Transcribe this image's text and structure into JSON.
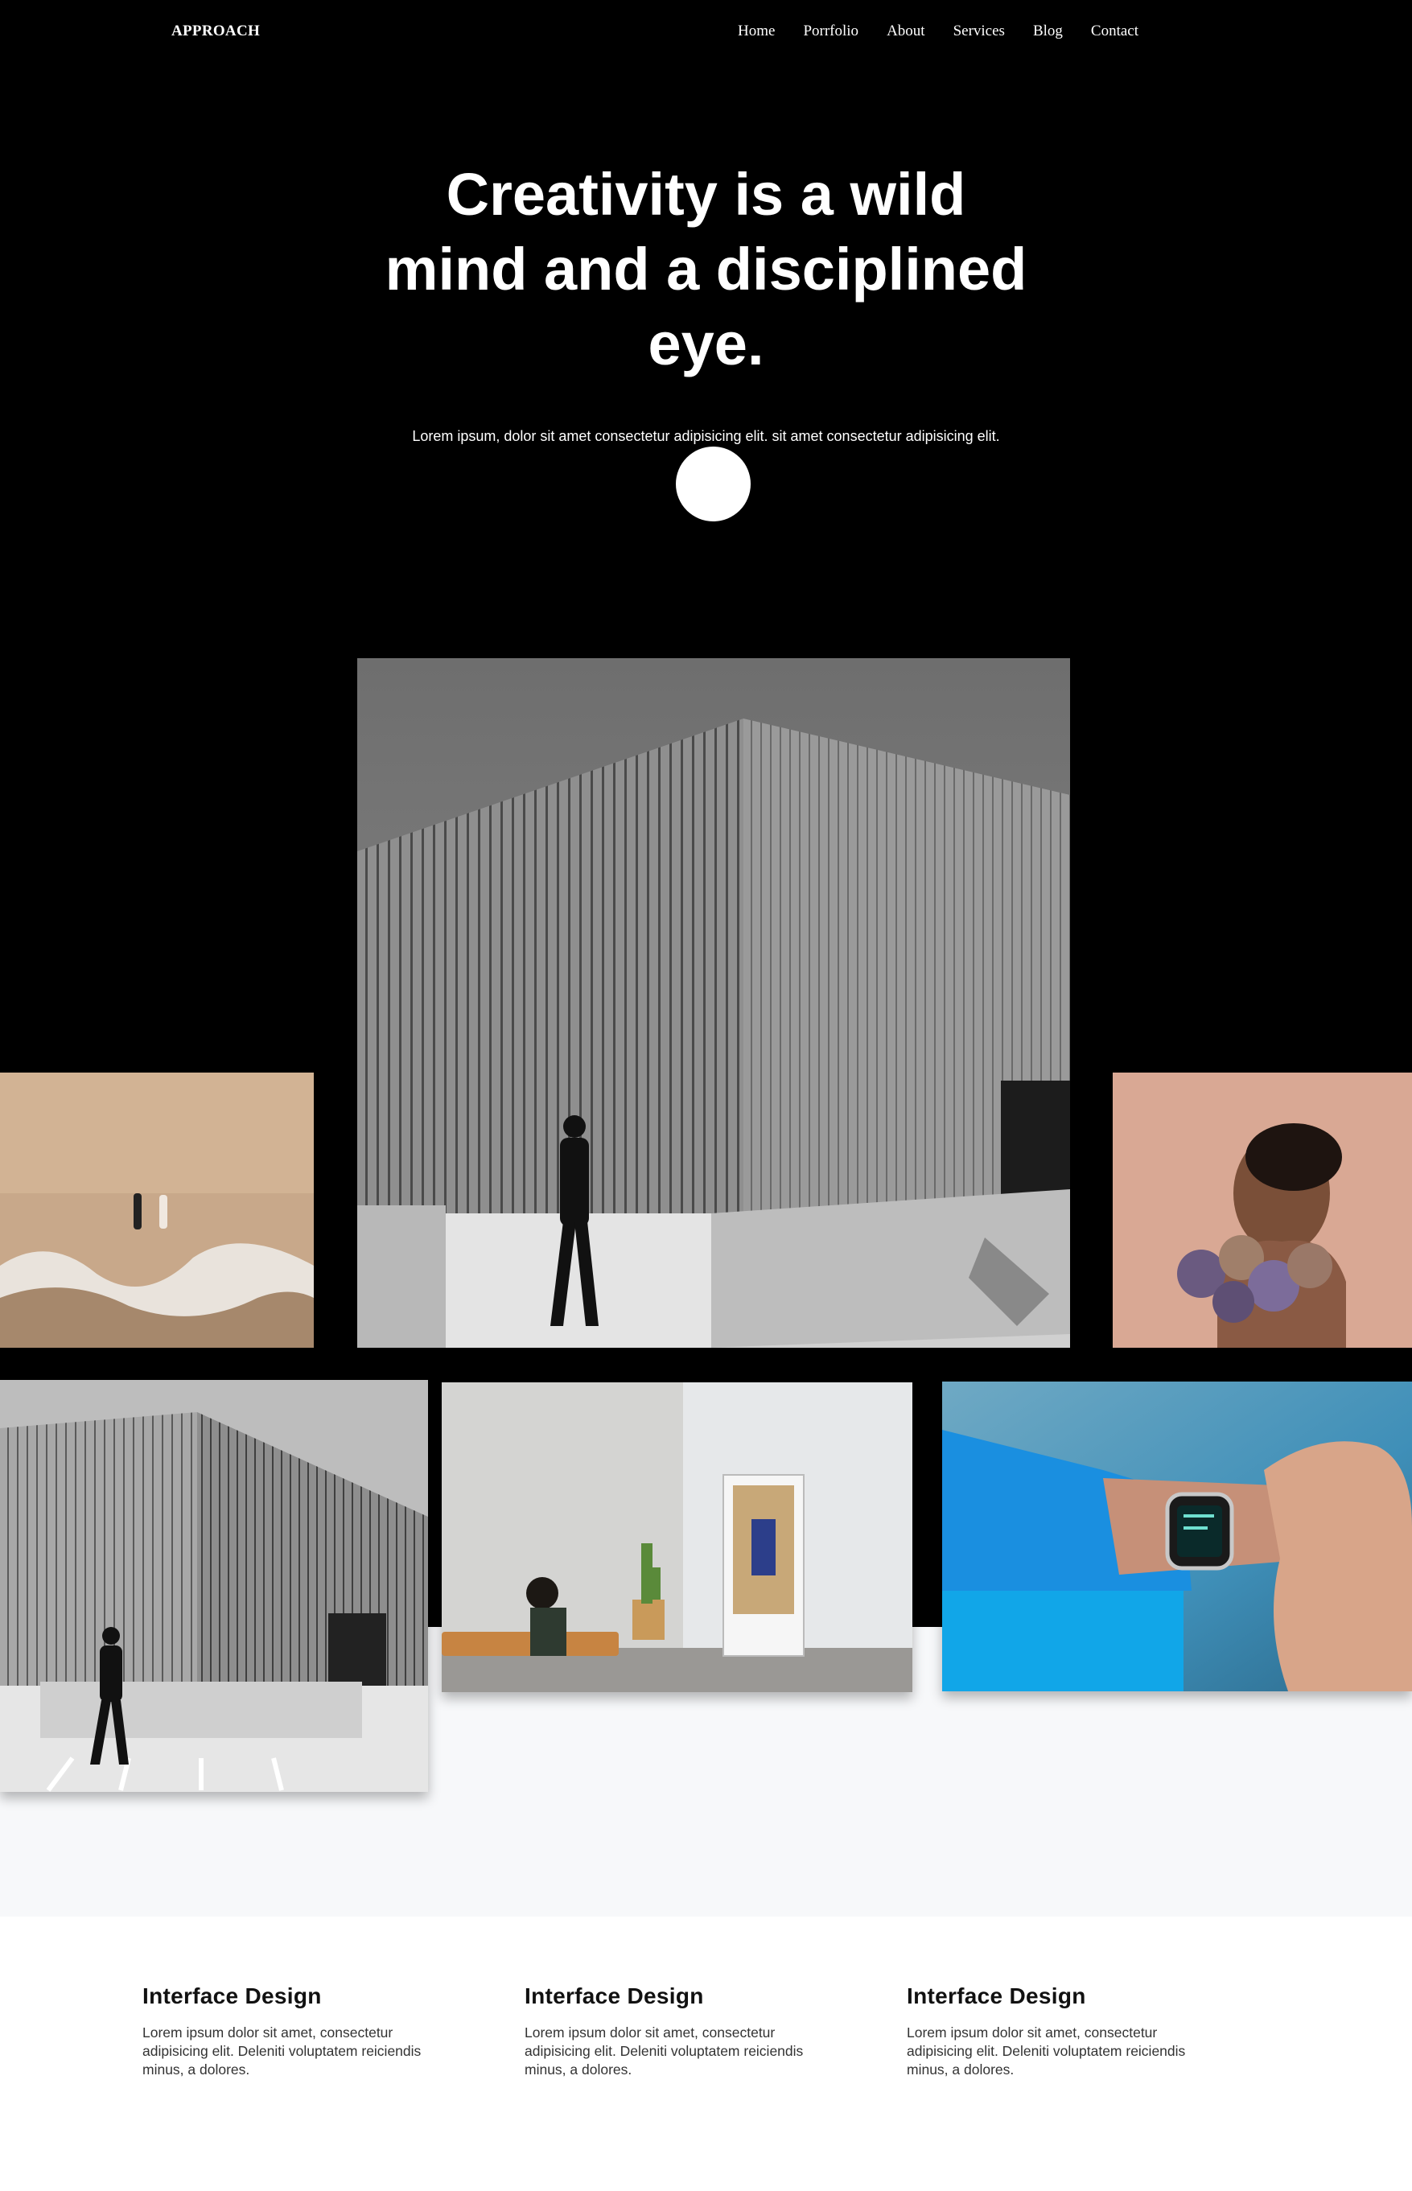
{
  "nav": {
    "brand": "APPROACH",
    "items": [
      "Home",
      "Porrfolio",
      "About",
      "Services",
      "Blog",
      "Contact"
    ]
  },
  "hero": {
    "headline_lines": [
      "Creativity is a wild",
      "mind and a disciplined",
      "eye."
    ],
    "subtitle": "Lorem ipsum, dolor sit amet consectetur adipisicing elit. sit amet consectetur adipisicing elit."
  },
  "gallery": {
    "images": [
      {
        "name": "concrete-building-photo"
      },
      {
        "name": "beach-aerial-photo"
      },
      {
        "name": "man-with-flowers-photo"
      },
      {
        "name": "concrete-building-photo-2"
      },
      {
        "name": "office-interior-photo"
      },
      {
        "name": "smartwatch-photo"
      }
    ]
  },
  "features": [
    {
      "title": "Interface Design",
      "text": "Lorem ipsum dolor sit amet, consectetur adipisicing elit. Deleniti voluptatem reiciendis minus, a dolores."
    },
    {
      "title": "Interface Design",
      "text": "Lorem ipsum dolor sit amet, consectetur adipisicing elit. Deleniti voluptatem reiciendis minus, a dolores."
    },
    {
      "title": "Interface Design",
      "text": "Lorem ipsum dolor sit amet, consectetur adipisicing elit. Deleniti voluptatem reiciendis minus, a dolores."
    }
  ]
}
